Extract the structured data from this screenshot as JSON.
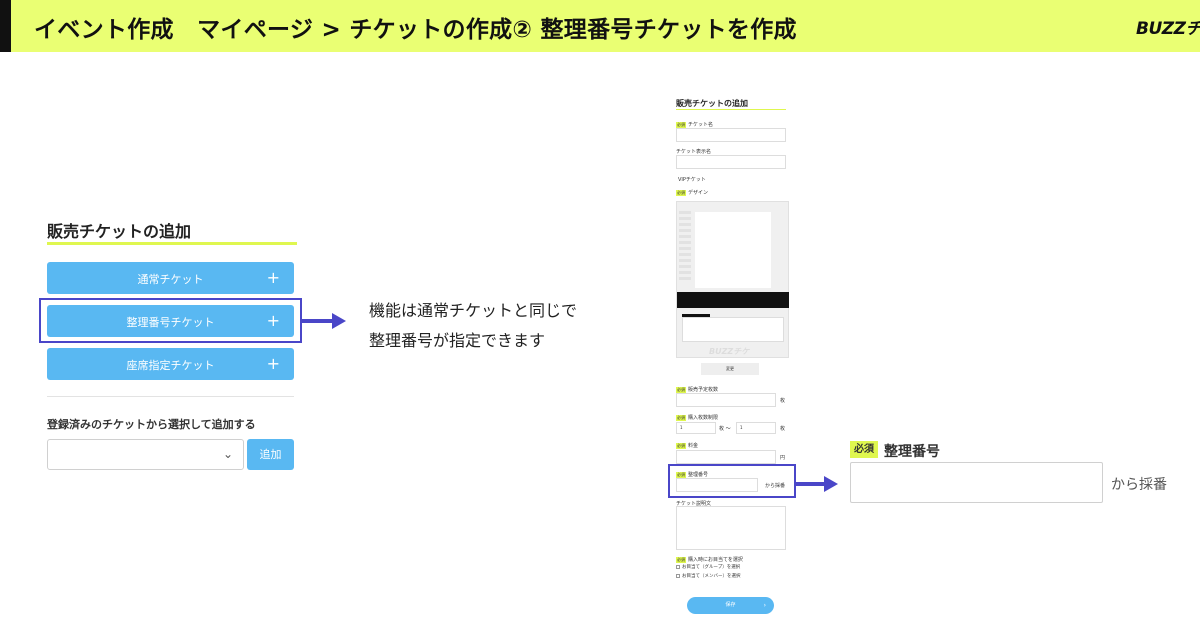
{
  "header": {
    "title": "イベント作成　マイページ > チケットの作成②  整理番号チケットを作成",
    "logo": "BUZZチケ"
  },
  "left_panel": {
    "title": "販売チケットの追加",
    "buttons": [
      {
        "label": "通常チケット",
        "plus": "+"
      },
      {
        "label": "整理番号チケット",
        "plus": "+"
      },
      {
        "label": "座席指定チケット",
        "plus": "+"
      }
    ],
    "registered_label": "登録済みのチケットから選択して追加する",
    "add_button": "追加"
  },
  "description": {
    "line1": "機能は通常チケットと同じで",
    "line2": "整理番号が指定できます"
  },
  "phone_form": {
    "title": "販売チケットの追加",
    "required": "必須",
    "ticket_name": "チケット名",
    "ticket_display_name": "チケット表示名",
    "vip": "VIPチケット",
    "design": "デザイン",
    "design_watermark": "BUZZチケ",
    "change": "変更",
    "sales_count": "販売予定枚数",
    "unit_sheets": "枚",
    "purchase_limit": "購入枚数制限",
    "limit_min": "1",
    "limit_max": "1",
    "limit_sep": "枚 〜",
    "price": "料金",
    "unit_yen": "円",
    "queue_number": "整理番号",
    "from_assign": "から採番",
    "ticket_description": "チケット説明文",
    "assign_seat": "購入時にお目当てを選択",
    "option_group": "お目当て（グループ）を選択",
    "option_member": "お目当て（メンバー）を選択",
    "save": "保存"
  },
  "zoomed_field": {
    "required": "必須",
    "label": "整理番号",
    "suffix": "から採番"
  },
  "colors": {
    "header_bg": "#eaff73",
    "accent_blue": "#59b8f2",
    "highlight": "#4a46c8",
    "required_badge": "#dff74f"
  }
}
